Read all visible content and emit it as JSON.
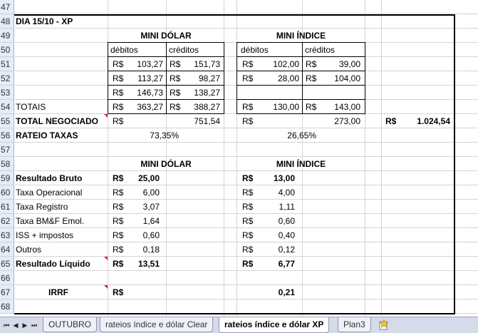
{
  "rows": [
    "47",
    "48",
    "49",
    "50",
    "51",
    "52",
    "53",
    "54",
    "55",
    "56",
    "57",
    "58",
    "59",
    "60",
    "61",
    "62",
    "63",
    "64",
    "65",
    "66",
    "67",
    "68"
  ],
  "title": "DIA 15/10 - XP",
  "section1": {
    "mini_dolar": "MINI DÓLAR",
    "mini_indice": "MINI ÍNDICE",
    "debitos": "débitos",
    "creditos": "créditos",
    "currency": "R$",
    "dolar_debitos": [
      "103,27",
      "113,27",
      "146,73"
    ],
    "dolar_creditos": [
      "151,73",
      "98,27",
      "138,27"
    ],
    "indice_debitos": [
      "102,00",
      "28,00"
    ],
    "indice_creditos": [
      "39,00",
      "104,00"
    ],
    "totais_label": "TOTAIS",
    "totais": {
      "dolar_deb": "363,27",
      "dolar_cred": "388,27",
      "indice_deb": "130,00",
      "indice_cred": "143,00"
    },
    "total_negociado_label": "TOTAL NEGOCIADO",
    "total_negociado": {
      "dolar": "751,54",
      "indice": "273,00",
      "geral": "1.024,54"
    },
    "rateio_label": "RATEIO TAXAS",
    "rateio": {
      "dolar": "73,35%",
      "indice": "26,65%"
    }
  },
  "section2": {
    "mini_dolar": "MINI DÓLAR",
    "mini_indice": "MINI ÍNDICE",
    "currency": "R$",
    "items": [
      {
        "label": "Resultado Bruto",
        "dolar": "25,00",
        "indice": "13,00",
        "bold": true
      },
      {
        "label": "Taxa Operacional",
        "dolar": "6,00",
        "indice": "4,00",
        "bold": false
      },
      {
        "label": "Taxa Registro",
        "dolar": "3,07",
        "indice": "1,11",
        "bold": false
      },
      {
        "label": "Taxa BM&F Emol.",
        "dolar": "1,64",
        "indice": "0,60",
        "bold": false
      },
      {
        "label": "ISS + impostos",
        "dolar": "0,60",
        "indice": "0,40",
        "bold": false
      },
      {
        "label": "Outros",
        "dolar": "0,18",
        "indice": "0,12",
        "bold": false
      },
      {
        "label": "Resultado Líquido",
        "dolar": "13,51",
        "indice": "6,77",
        "bold": true
      }
    ],
    "irrf_label": "IRRF",
    "irrf_value": "0,21"
  },
  "tabs": [
    {
      "label": "OUTUBRO",
      "active": false
    },
    {
      "label": "rateios índice e dólar Clear",
      "active": false
    },
    {
      "label": "rateios índice e dólar XP",
      "active": true
    },
    {
      "label": "Plan3",
      "active": false
    }
  ],
  "nav_icons": [
    "first-sheet-icon",
    "prev-sheet-icon",
    "next-sheet-icon",
    "last-sheet-icon"
  ]
}
